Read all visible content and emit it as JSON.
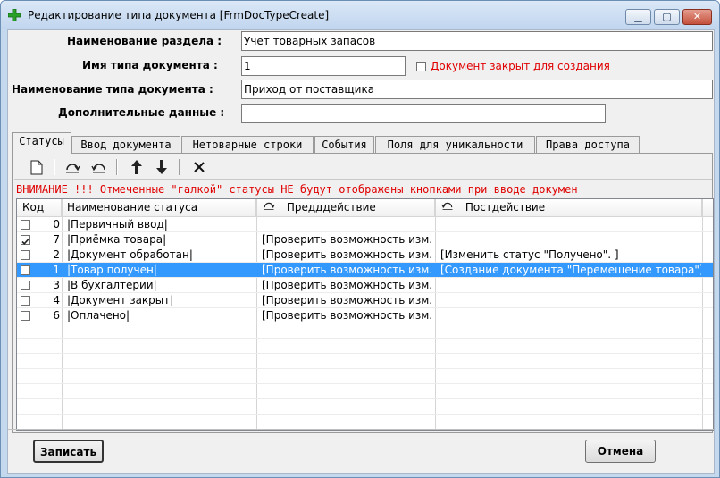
{
  "window": {
    "title": "Редактирование типа документа [FrmDocTypeCreate]",
    "controls": {
      "minimize": "▁",
      "maximize": "▢",
      "close": "✕"
    }
  },
  "form": {
    "section_label": "Наименование раздела :",
    "section_value": "Учет товарных запасов",
    "type_name_label": "Имя типа документа :",
    "type_name_value": "1",
    "closed_checkbox_label": "Документ закрыт для создания",
    "closed_checked": false,
    "type_title_label": "Наименование типа документа :",
    "type_title_value": "Приход от поставщика",
    "extra_label": "Дополнительные данные :",
    "extra_value": ""
  },
  "tabs": [
    "Статусы",
    "Ввод документа",
    "Нетоварные строки",
    "События",
    "Поля для уникальности",
    "Права доступа"
  ],
  "active_tab": 0,
  "toolbar": {
    "icons": [
      "new-document-icon",
      "pre-action-icon",
      "post-action-icon",
      "move-up-icon",
      "move-down-icon",
      "delete-icon"
    ]
  },
  "warning": "ВНИМАНИЕ !!! Отмеченные \"галкой\" статусы НЕ будут отображены кнопками при вводе докумен",
  "table": {
    "columns": [
      "Код",
      "Наименование статуса",
      "Предддействие",
      "Постдействие"
    ],
    "rows": [
      {
        "checked": false,
        "code": "0",
        "name": "|Первичный ввод|",
        "pre": "",
        "post": ""
      },
      {
        "checked": true,
        "code": "7",
        "name": "|Приёмка товара|",
        "pre": "[Проверить возможность изм...",
        "post": ""
      },
      {
        "checked": false,
        "code": "2",
        "name": "|Документ обработан|",
        "pre": "[Проверить возможность изм...",
        "post": "[Изменить статус \"Получено\". ]"
      },
      {
        "checked": false,
        "code": "1",
        "name": "|Товар получен|",
        "pre": "[Проверить возможность изм...",
        "post": "[Создание документа \"Перемещение товара\"]"
      },
      {
        "checked": false,
        "code": "3",
        "name": "|В бухгалтерии|",
        "pre": "[Проверить возможность изм...",
        "post": ""
      },
      {
        "checked": false,
        "code": "4",
        "name": "|Документ закрыт|",
        "pre": "[Проверить возможность изм...",
        "post": ""
      },
      {
        "checked": false,
        "code": "6",
        "name": "|Оплачено|",
        "pre": "[Проверить возможность изм...",
        "post": ""
      }
    ],
    "selected_row": 3
  },
  "buttons": {
    "save": "Записать",
    "cancel": "Отмена"
  },
  "colors": {
    "selection": "#3399ff",
    "warning": "#e00000",
    "app_icon": "#2aa02a"
  }
}
